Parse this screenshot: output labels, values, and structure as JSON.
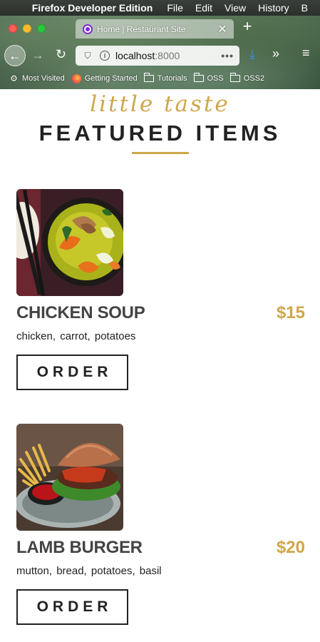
{
  "menubar": {
    "app_name": "Firefox Developer Edition",
    "items": [
      "File",
      "Edit",
      "View",
      "History",
      "B"
    ]
  },
  "browser": {
    "tab_title": "Home | Restaurant Site",
    "url_host": "localhost",
    "url_port": ":8000",
    "bookmarks": [
      {
        "label": "Most Visited",
        "icon": "gear-icon"
      },
      {
        "label": "Getting Started",
        "icon": "firefox-icon"
      },
      {
        "label": "Tutorials",
        "icon": "folder-icon"
      },
      {
        "label": "OSS",
        "icon": "folder-icon"
      },
      {
        "label": "OSS2",
        "icon": "folder-icon"
      }
    ]
  },
  "page": {
    "subtitle": "little taste",
    "title": "FEATURED ITEMS",
    "accent_color": "#cfa64b",
    "items": [
      {
        "name": "CHICKEN SOUP",
        "price": "$15",
        "ingredients": "chicken, carrot, potatoes",
        "order_label": "ORDER",
        "photo": "chicken-soup-photo"
      },
      {
        "name": "LAMB BURGER",
        "price": "$20",
        "ingredients": "mutton, bread, potatoes, basil",
        "order_label": "ORDER",
        "photo": "lamb-burger-photo"
      }
    ]
  }
}
